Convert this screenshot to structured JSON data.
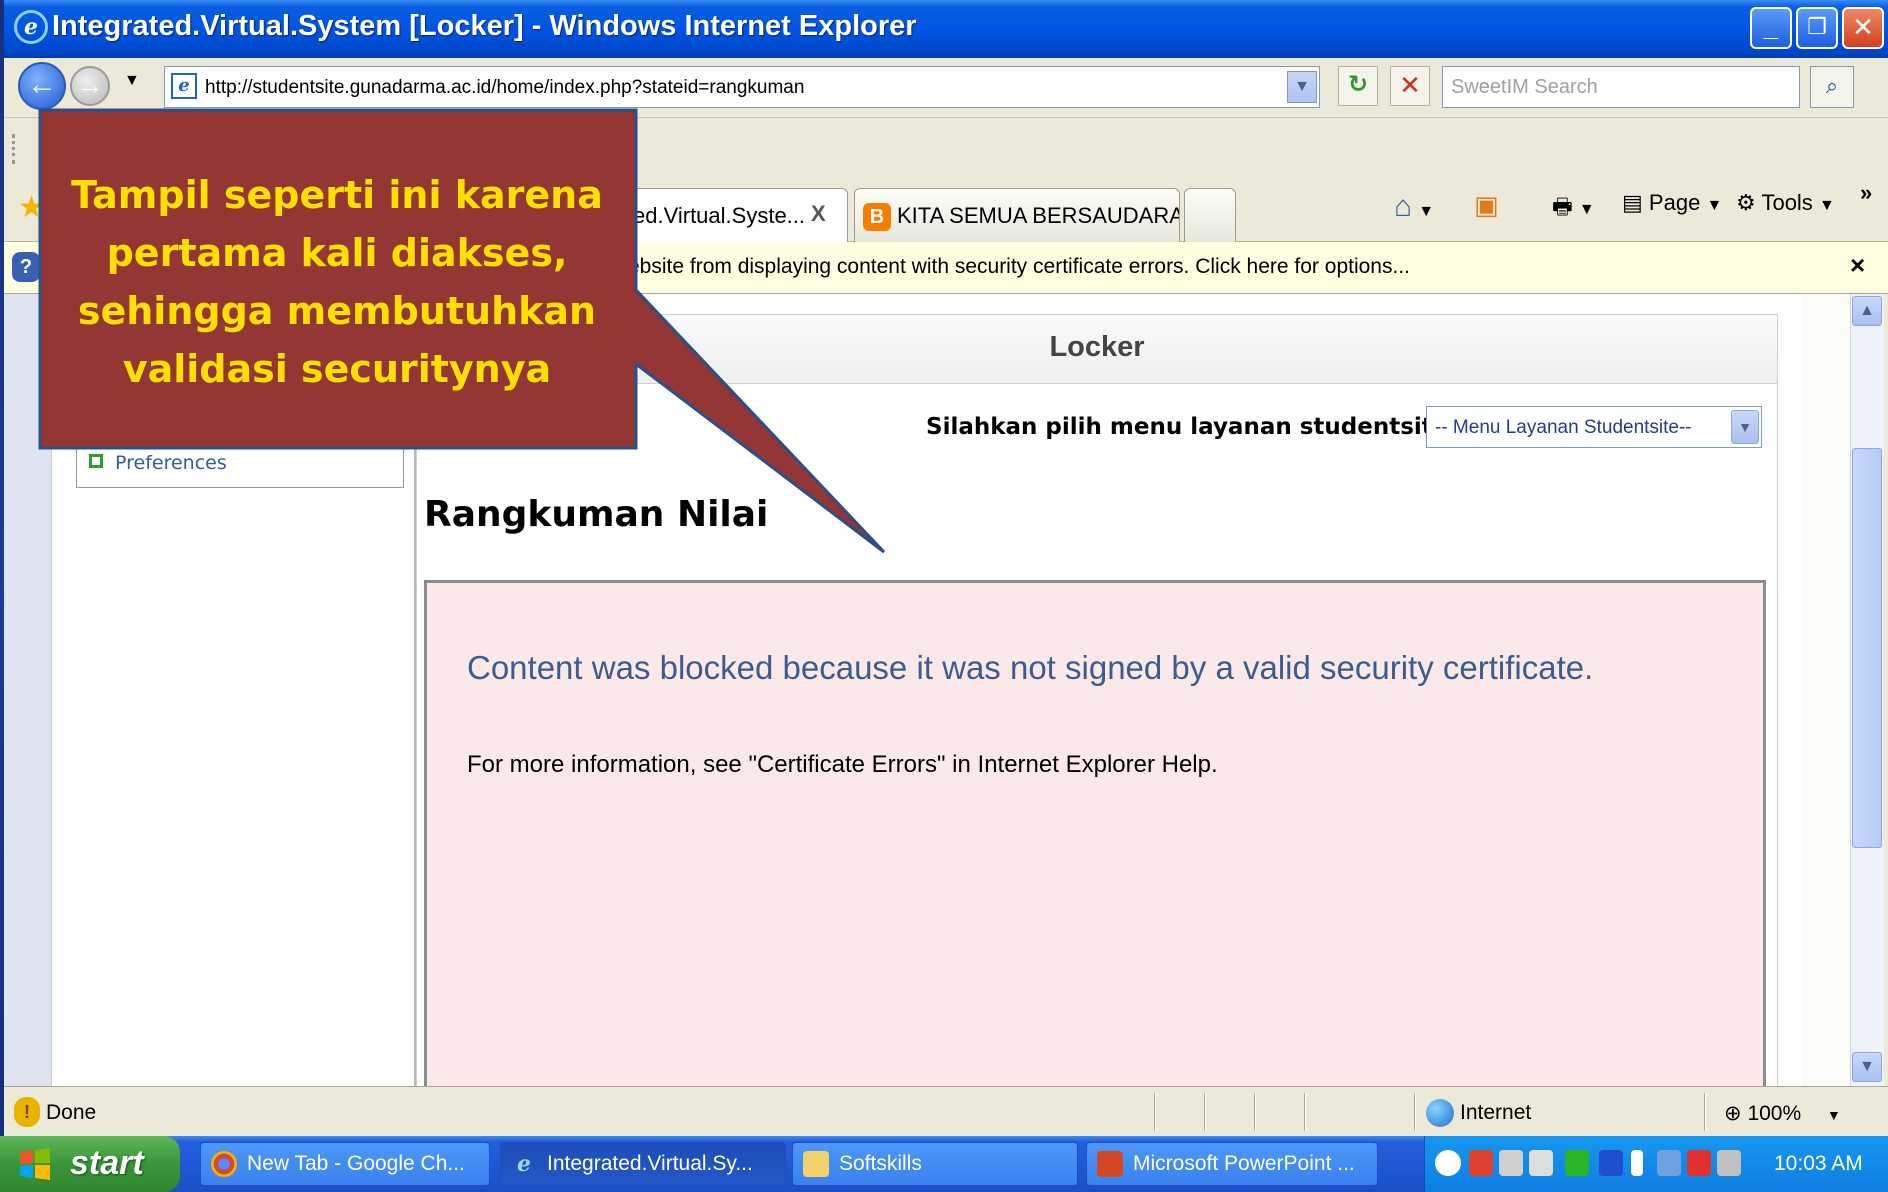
{
  "window": {
    "title": "Integrated.Virtual.System [Locker] - Windows Internet Explorer",
    "minimize": "_",
    "restore": "❐",
    "close": "✕"
  },
  "address_bar": {
    "url": "http://studentsite.gunadarma.ac.id/home/index.php?stateid=rangkuman",
    "search_placeholder": "SweetIM Search"
  },
  "tabs": [
    {
      "label": "Integrated.Virtual.Syste...",
      "visible_label": "ed.Virtual.Syste...",
      "close": "X"
    },
    {
      "label": "KITA SEMUA BERSAUDARA: ..."
    }
  ],
  "command_bar": {
    "page": "Page",
    "tools": "Tools",
    "more": "»"
  },
  "info_bar": {
    "text": "ebsite from displaying content with security certificate errors. Click here for options...",
    "close": "×"
  },
  "sidebar": {
    "preferences": "Preferences"
  },
  "page": {
    "locker_title": "Locker",
    "menu_label": "Silahkan pilih menu layanan studentsite :",
    "menu_selected": "-- Menu Layanan Studentsite--",
    "heading": "Rangkuman Nilai",
    "blocked_message": "Content was blocked because it was not signed by a valid security certificate.",
    "blocked_info": "For more information, see \"Certificate Errors\" in Internet Explorer Help."
  },
  "status_bar": {
    "status": "Done",
    "zone": "Internet",
    "zoom": "100%"
  },
  "taskbar": {
    "start": "start",
    "tasks": [
      {
        "label": "New Tab - Google Ch..."
      },
      {
        "label": "Integrated.Virtual.Sy..."
      },
      {
        "label": "Softskills"
      },
      {
        "label": "Microsoft PowerPoint ..."
      }
    ],
    "clock": "10:03 AM"
  },
  "callout": {
    "lines": [
      "Tampil seperti ini karena",
      "pertama kali diakses,",
      "sehingga membutuhkan",
      "validasi securitynya"
    ]
  },
  "colors": {
    "callout_fill": "#943634",
    "callout_text": "#ffe000",
    "blocked_bg": "#fbe9e9",
    "blocked_text": "#3b5c91",
    "title_bar": "#0055e5",
    "taskbar": "#245edb",
    "start_button": "#3a963a"
  }
}
